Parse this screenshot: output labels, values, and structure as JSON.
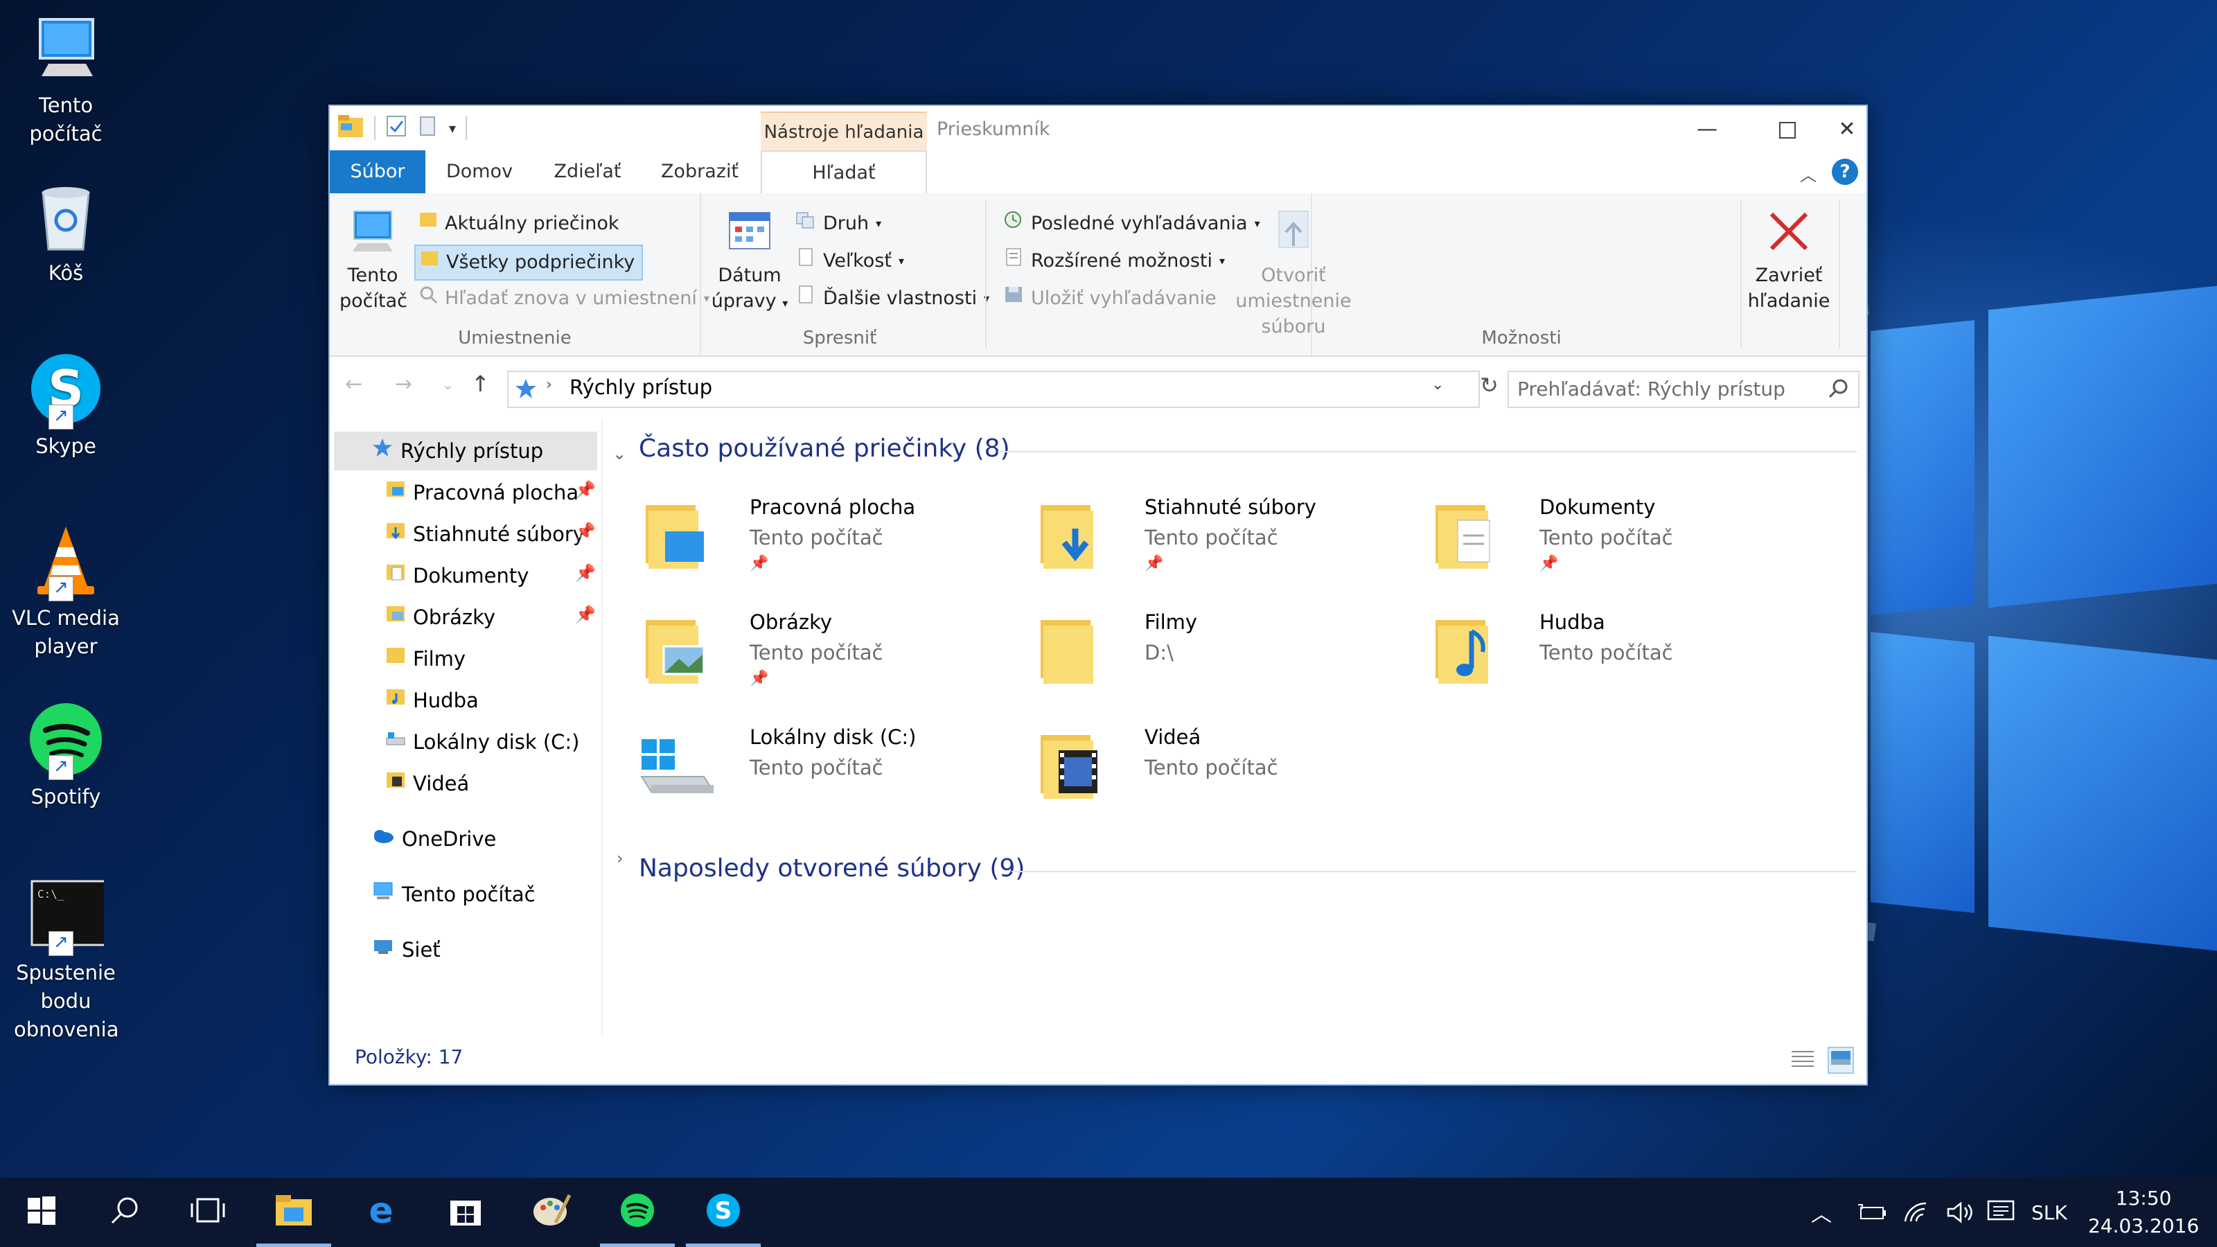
{
  "desktop": {
    "icons": [
      {
        "label": "Tento počítač",
        "icon": "computer-icon"
      },
      {
        "label": "Kôš",
        "icon": "recycle-bin-icon"
      },
      {
        "label": "Skype",
        "icon": "skype-icon"
      },
      {
        "label": "VLC media player",
        "icon": "vlc-icon"
      },
      {
        "label": "Spotify",
        "icon": "spotify-icon"
      },
      {
        "label": "Spustenie bodu obnovenia",
        "icon": "console-icon"
      }
    ]
  },
  "window": {
    "title": "Prieskumník",
    "context_tab": "Nástroje hľadania",
    "tabs": [
      "Súbor",
      "Domov",
      "Zdieľať",
      "Zobraziť",
      "Hľadať"
    ],
    "ribbon": {
      "location": {
        "big_label_1": "Tento",
        "big_label_2": "počítač",
        "items": [
          "Aktuálny priečinok",
          "Všetky podpriečinky",
          "Hľadať znova v umiestnení"
        ],
        "group_label": "Umiestnenie"
      },
      "refine": {
        "big_label_1": "Dátum",
        "big_label_2": "úpravy",
        "items": [
          "Druh",
          "Veľkosť",
          "Ďalšie vlastnosti"
        ],
        "group_label": "Spresniť"
      },
      "options": {
        "items": [
          "Posledné vyhľadávania",
          "Rozšírené možnosti",
          "Uložiť vyhľadávanie"
        ],
        "open_location_1": "Otvoriť umiestnenie",
        "open_location_2": "súboru",
        "group_label": "Možnosti"
      },
      "close": {
        "label_1": "Zavrieť",
        "label_2": "hľadanie"
      }
    },
    "address": {
      "path": "Rýchly prístup",
      "search_placeholder": "Prehľadávať: Rýchly prístup"
    },
    "nav": {
      "quick_access": "Rýchly prístup",
      "items": [
        {
          "label": "Pracovná plocha",
          "pinned": true
        },
        {
          "label": "Stiahnuté súbory",
          "pinned": true
        },
        {
          "label": "Dokumenty",
          "pinned": true
        },
        {
          "label": "Obrázky",
          "pinned": true
        },
        {
          "label": "Filmy",
          "pinned": false
        },
        {
          "label": "Hudba",
          "pinned": false
        },
        {
          "label": "Lokálny disk (C:)",
          "pinned": false
        },
        {
          "label": "Videá",
          "pinned": false
        }
      ],
      "onedrive": "OneDrive",
      "this_pc": "Tento počítač",
      "network": "Sieť"
    },
    "content": {
      "frequent_title": "Často používané priečinky (8)",
      "recent_title": "Naposledy otvorené súbory (9)",
      "folders": [
        {
          "name": "Pracovná plocha",
          "location": "Tento počítač",
          "pinned": true,
          "icon": "desktop-folder-icon"
        },
        {
          "name": "Stiahnuté súbory",
          "location": "Tento počítač",
          "pinned": true,
          "icon": "downloads-folder-icon"
        },
        {
          "name": "Dokumenty",
          "location": "Tento počítač",
          "pinned": true,
          "icon": "documents-folder-icon"
        },
        {
          "name": "Obrázky",
          "location": "Tento počítač",
          "pinned": true,
          "icon": "pictures-folder-icon"
        },
        {
          "name": "Filmy",
          "location": "D:\\",
          "pinned": false,
          "icon": "folder-icon"
        },
        {
          "name": "Hudba",
          "location": "Tento počítač",
          "pinned": false,
          "icon": "music-folder-icon"
        },
        {
          "name": "Lokálny disk (C:)",
          "location": "Tento počítač",
          "pinned": false,
          "icon": "drive-icon"
        },
        {
          "name": "Videá",
          "location": "Tento počítač",
          "pinned": false,
          "icon": "videos-folder-icon"
        }
      ]
    },
    "status": {
      "items": "Položky: 17"
    }
  },
  "taskbar": {
    "lang": "SLK",
    "time": "13:50",
    "date": "24.03.2016"
  },
  "colors": {
    "accent": "#1979ca",
    "heading": "#1e3287",
    "context_tab_bg": "#fde8d5",
    "taskbar_bg": "#0b1730"
  }
}
